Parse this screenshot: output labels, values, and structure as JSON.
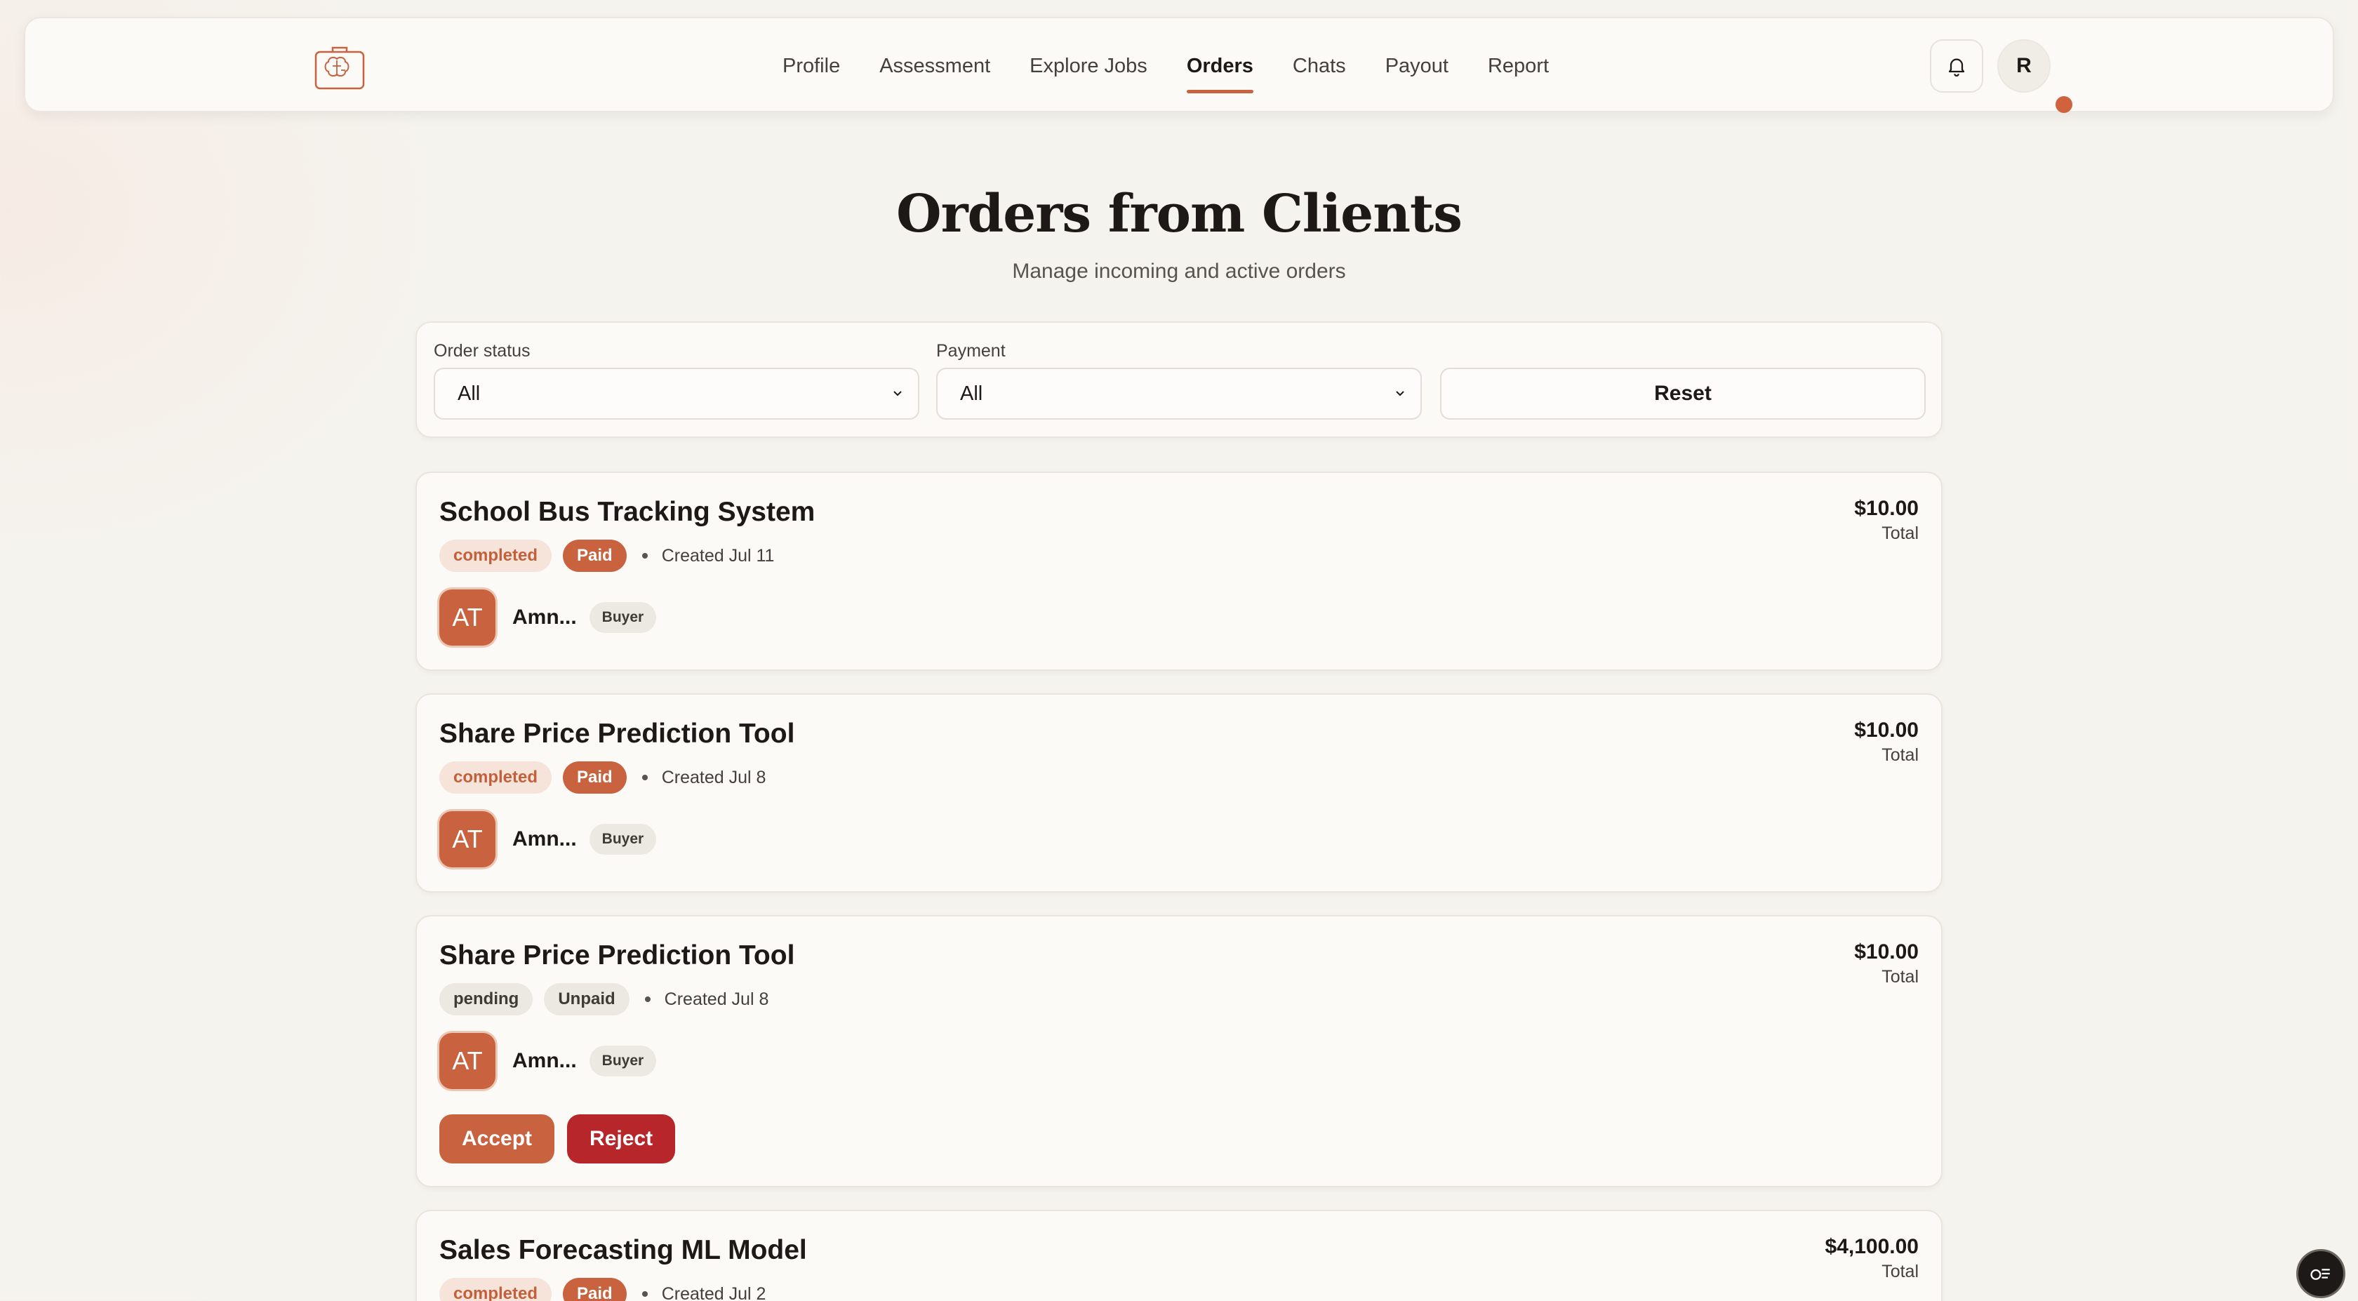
{
  "nav": {
    "links": [
      "Profile",
      "Assessment",
      "Explore Jobs",
      "Orders",
      "Chats",
      "Payout",
      "Report"
    ],
    "active": "Orders",
    "avatar_initial": "R"
  },
  "header": {
    "title": "Orders from Clients",
    "subtitle": "Manage incoming and active orders"
  },
  "filters": {
    "order_status_label": "Order status",
    "order_status_value": "All",
    "payment_label": "Payment",
    "payment_value": "All",
    "reset_label": "Reset"
  },
  "orders": [
    {
      "title": "School Bus Tracking System",
      "amount": "$10.00",
      "total_label": "Total",
      "status": "completed",
      "payment": "Paid",
      "created": "Created Jul 11",
      "client_initials": "AT",
      "client_name": "Amn...",
      "role": "Buyer"
    },
    {
      "title": "Share Price Prediction Tool",
      "amount": "$10.00",
      "total_label": "Total",
      "status": "completed",
      "payment": "Paid",
      "created": "Created Jul 8",
      "client_initials": "AT",
      "client_name": "Amn...",
      "role": "Buyer"
    },
    {
      "title": "Share Price Prediction Tool",
      "amount": "$10.00",
      "total_label": "Total",
      "status": "pending",
      "payment": "Unpaid",
      "created": "Created Jul 8",
      "client_initials": "AT",
      "client_name": "Amn...",
      "role": "Buyer",
      "accept_label": "Accept",
      "reject_label": "Reject"
    },
    {
      "title": "Sales Forecasting ML Model",
      "amount": "$4,100.00",
      "total_label": "Total",
      "status": "completed",
      "payment": "Paid",
      "created": "Created Jul 2"
    }
  ],
  "colors": {
    "accent": "#c8623f",
    "reject": "#b7262b",
    "background": "#f5f3ee",
    "card": "#fbfaf7"
  },
  "icons": [
    "brain-logo-icon",
    "bell-icon",
    "chevron-down-icon",
    "chat-list-icon"
  ]
}
